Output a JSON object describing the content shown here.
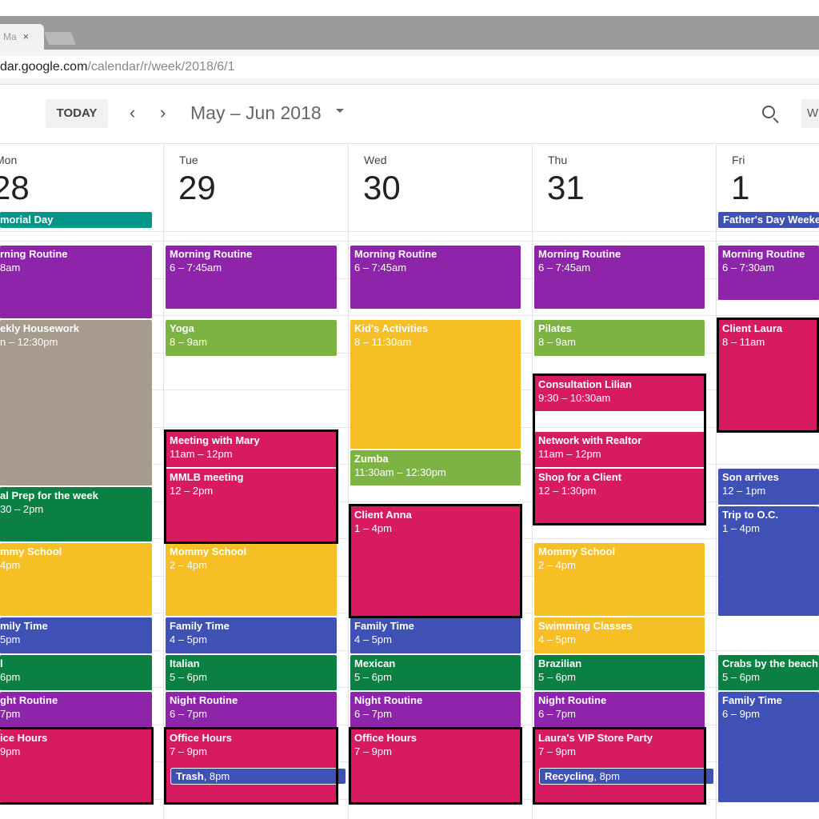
{
  "browser": {
    "tab_title": "Ma",
    "tab_close": "×",
    "url_host": "dar.google.com",
    "url_path": "/calendar/r/week/2018/6/1"
  },
  "toolbar": {
    "today_label": "TODAY",
    "prev": "‹",
    "next": "›",
    "date_range": "May – Jun 2018",
    "view_label": "W"
  },
  "colors": {
    "purple": "#8e24aa",
    "green": "#7cb342",
    "pink": "#d81b60",
    "yellow": "#f6bf26",
    "blue": "#3f51b5",
    "darkgreen": "#0b8043",
    "grey": "#a79b8e",
    "teal": "#009688"
  },
  "days": [
    {
      "dow": "Mon",
      "num": "28",
      "allday": {
        "title": "morial Day",
        "color": "#009688"
      },
      "events": [
        {
          "title": "rning Routine",
          "time": "8am",
          "start": 6,
          "end": 8,
          "color": "#8e24aa"
        },
        {
          "title": "ekly Housework",
          "time": "n – 12:30pm",
          "start": 8,
          "end": 12.5,
          "color": "#a79b8e"
        },
        {
          "title": "al Prep for the week",
          "time": "30 – 2pm",
          "start": 12.5,
          "end": 14,
          "color": "#0b8043"
        },
        {
          "title": "mmy School",
          "time": "4pm",
          "start": 14,
          "end": 16,
          "color": "#f6bf26"
        },
        {
          "title": "mily Time",
          "time": "5pm",
          "start": 16,
          "end": 17,
          "color": "#3f51b5"
        },
        {
          "title": "l",
          "time": "6pm",
          "start": 17,
          "end": 18,
          "color": "#0b8043"
        },
        {
          "title": "ght Routine",
          "time": "7pm",
          "start": 18,
          "end": 19,
          "color": "#8e24aa"
        },
        {
          "title": "ice Hours",
          "time": "9pm",
          "start": 19,
          "end": 21,
          "color": "#d81b60"
        }
      ],
      "highlights": [
        {
          "start": 19,
          "end": 21
        }
      ]
    },
    {
      "dow": "Tue",
      "num": "29",
      "events": [
        {
          "title": "Morning Routine",
          "time": "6 – 7:45am",
          "start": 6,
          "end": 7.75,
          "color": "#8e24aa"
        },
        {
          "title": "Yoga",
          "time": "8 – 9am",
          "start": 8,
          "end": 9,
          "color": "#7cb342"
        },
        {
          "title": "Meeting with Mary",
          "time": "11am – 12pm",
          "start": 11,
          "end": 12,
          "color": "#d81b60"
        },
        {
          "title": "MMLB meeting",
          "time": "12 – 2pm",
          "start": 12,
          "end": 14,
          "color": "#d81b60"
        },
        {
          "title": "Mommy School",
          "time": "2 – 4pm",
          "start": 14,
          "end": 16,
          "color": "#f6bf26"
        },
        {
          "title": "Family Time",
          "time": "4 – 5pm",
          "start": 16,
          "end": 17,
          "color": "#3f51b5"
        },
        {
          "title": "Italian",
          "time": "5 – 6pm",
          "start": 17,
          "end": 18,
          "color": "#0b8043"
        },
        {
          "title": "Night Routine",
          "time": "6 – 7pm",
          "start": 18,
          "end": 19,
          "color": "#8e24aa"
        },
        {
          "title": "Office Hours",
          "time": "7 – 9pm",
          "start": 19,
          "end": 21,
          "color": "#d81b60"
        }
      ],
      "chip": {
        "title": "Trash",
        "time": ", 8pm",
        "at": 20
      },
      "highlights": [
        {
          "start": 11,
          "end": 14
        },
        {
          "start": 19,
          "end": 21
        }
      ]
    },
    {
      "dow": "Wed",
      "num": "30",
      "events": [
        {
          "title": "Morning Routine",
          "time": "6 – 7:45am",
          "start": 6,
          "end": 7.75,
          "color": "#8e24aa"
        },
        {
          "title": "Kid's Activities",
          "time": "8 – 11:30am",
          "start": 8,
          "end": 11.5,
          "color": "#f6bf26"
        },
        {
          "title": "Zumba",
          "time": "11:30am – 12:30pm",
          "start": 11.5,
          "end": 12.5,
          "color": "#7cb342"
        },
        {
          "title": "Client Anna",
          "time": "1 – 4pm",
          "start": 13,
          "end": 16,
          "color": "#d81b60"
        },
        {
          "title": "Family Time",
          "time": "4 – 5pm",
          "start": 16,
          "end": 17,
          "color": "#3f51b5"
        },
        {
          "title": "Mexican",
          "time": "5 – 6pm",
          "start": 17,
          "end": 18,
          "color": "#0b8043"
        },
        {
          "title": "Night Routine",
          "time": "6 – 7pm",
          "start": 18,
          "end": 19,
          "color": "#8e24aa"
        },
        {
          "title": "Office Hours",
          "time": "7 – 9pm",
          "start": 19,
          "end": 21,
          "color": "#d81b60"
        }
      ],
      "highlights": [
        {
          "start": 13,
          "end": 16
        },
        {
          "start": 19,
          "end": 21
        }
      ]
    },
    {
      "dow": "Thu",
      "num": "31",
      "events": [
        {
          "title": "Morning Routine",
          "time": "6 – 7:45am",
          "start": 6,
          "end": 7.75,
          "color": "#8e24aa"
        },
        {
          "title": "Pilates",
          "time": "8 – 9am",
          "start": 8,
          "end": 9,
          "color": "#7cb342"
        },
        {
          "title": "Consultation Lilian",
          "time": "9:30 – 10:30am",
          "start": 9.5,
          "end": 10.5,
          "color": "#d81b60"
        },
        {
          "title": "Network with Realtor",
          "time": "11am – 12pm",
          "start": 11,
          "end": 12,
          "color": "#d81b60"
        },
        {
          "title": "Shop for a Client",
          "time": "12 – 1:30pm",
          "start": 12,
          "end": 13.5,
          "color": "#d81b60"
        },
        {
          "title": "Mommy School",
          "time": "2 – 4pm",
          "start": 14,
          "end": 16,
          "color": "#f6bf26"
        },
        {
          "title": "Swimming Classes",
          "time": "4 – 5pm",
          "start": 16,
          "end": 17,
          "color": "#f6bf26"
        },
        {
          "title": "Brazilian",
          "time": "5 – 6pm",
          "start": 17,
          "end": 18,
          "color": "#0b8043"
        },
        {
          "title": "Night Routine",
          "time": "6 – 7pm",
          "start": 18,
          "end": 19,
          "color": "#8e24aa"
        },
        {
          "title": "Laura's VIP Store Party",
          "time": "7 – 9pm",
          "start": 19,
          "end": 21,
          "color": "#d81b60"
        }
      ],
      "chip": {
        "title": "Recycling",
        "time": ", 8pm",
        "at": 20
      },
      "highlights": [
        {
          "start": 9.5,
          "end": 13.5
        },
        {
          "start": 19,
          "end": 21
        }
      ]
    },
    {
      "dow": "Fri",
      "num": "1",
      "allday": {
        "title": "Father's Day Weekend",
        "color": "#3f51b5"
      },
      "events": [
        {
          "title": "Morning Routine",
          "time": "6 – 7:30am",
          "start": 6,
          "end": 7.5,
          "color": "#8e24aa"
        },
        {
          "title": "Client Laura",
          "time": "8 – 11am",
          "start": 8,
          "end": 11,
          "color": "#d81b60"
        },
        {
          "title": "Son arrives",
          "time": "12 – 1pm",
          "start": 12,
          "end": 13,
          "color": "#3f51b5"
        },
        {
          "title": "Trip to O.C.",
          "time": "1 – 4pm",
          "start": 13,
          "end": 16,
          "color": "#3f51b5"
        },
        {
          "title": "Crabs by the beach",
          "time": "5 – 6pm",
          "start": 17,
          "end": 18,
          "color": "#0b8043"
        },
        {
          "title": "Family Time",
          "time": "6 – 9pm",
          "start": 18,
          "end": 21,
          "color": "#3f51b5"
        }
      ],
      "highlights": [
        {
          "start": 8,
          "end": 11
        }
      ]
    }
  ]
}
